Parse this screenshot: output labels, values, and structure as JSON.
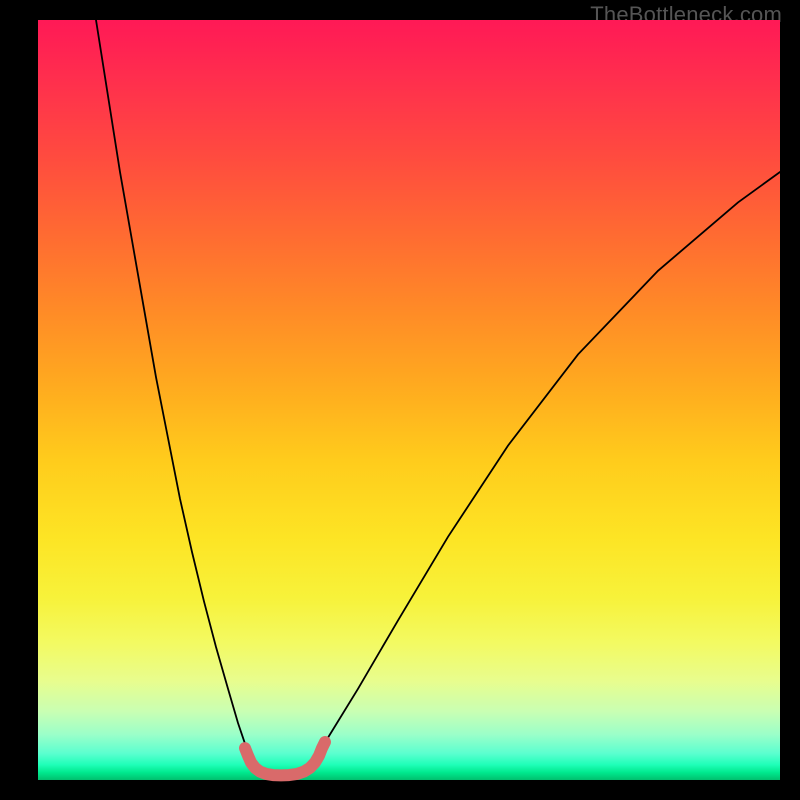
{
  "watermark": "TheBottleneck.com",
  "chart_data": {
    "type": "line",
    "title": "",
    "xlabel": "",
    "ylabel": "",
    "x_range": [
      0,
      742
    ],
    "y_range_percent": [
      0,
      100
    ],
    "left_branch": {
      "x": [
        58,
        70,
        82,
        94,
        106,
        118,
        130,
        142,
        154,
        166,
        178,
        190,
        200,
        209,
        215
      ],
      "y_percent": [
        100,
        90,
        80,
        71,
        62,
        53,
        45,
        37,
        30,
        23.5,
        17.5,
        12,
        7.5,
        4,
        2.6
      ]
    },
    "valley_marker": {
      "x": [
        207,
        210,
        213,
        217,
        222,
        228,
        235,
        243,
        251,
        259,
        266,
        272,
        277,
        281,
        284,
        287
      ],
      "y_percent": [
        4.2,
        3.2,
        2.3,
        1.6,
        1.1,
        0.8,
        0.65,
        0.6,
        0.65,
        0.8,
        1.1,
        1.6,
        2.3,
        3.2,
        4.2,
        5.0
      ]
    },
    "right_branch": {
      "x": [
        276,
        292,
        320,
        360,
        410,
        470,
        540,
        620,
        700,
        742
      ],
      "y_percent": [
        2.6,
        6,
        12,
        21,
        32,
        44,
        56,
        67,
        76,
        80
      ]
    },
    "notes": "V-shaped bottleneck curve. Percent maps top(100)→bottom(0) of plot. Minimum near x≈247 px at ~0.6%."
  }
}
